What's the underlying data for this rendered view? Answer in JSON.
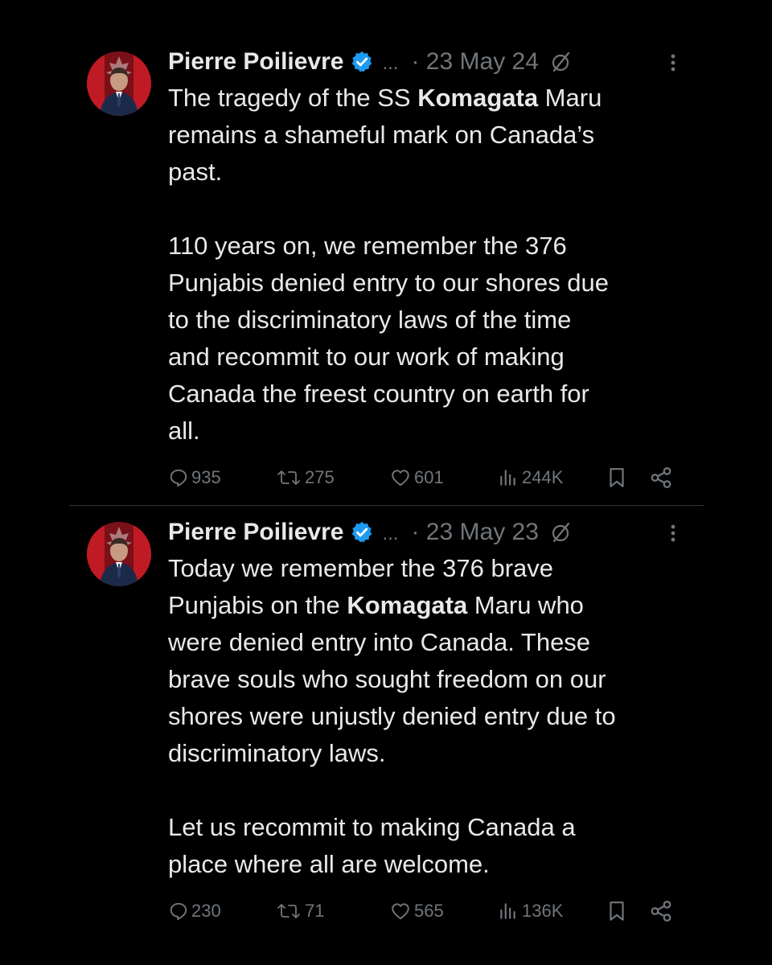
{
  "colors": {
    "background": "#000000",
    "text": "#e7e9ea",
    "secondary": "#71767b",
    "verified_badge": "#1d9bf0",
    "divider": "#2f3336"
  },
  "tweets": [
    {
      "author_name": "Pierre Poilievre",
      "ellipsis": "...",
      "date": "· 23 May 24",
      "body_lines": [
        [
          {
            "t": "The tragedy of the SS "
          },
          {
            "t": "Komagata",
            "b": true
          },
          {
            "t": " Maru"
          }
        ],
        [
          {
            "t": "remains a shameful mark on Canada’s"
          }
        ],
        [
          {
            "t": "past."
          }
        ],
        [],
        [
          {
            "t": "110 years on, we remember the 376"
          }
        ],
        [
          {
            "t": "Punjabis denied entry to our shores due"
          }
        ],
        [
          {
            "t": "to the discriminatory laws of the time"
          }
        ],
        [
          {
            "t": "and recommit to our work of making"
          }
        ],
        [
          {
            "t": "Canada the freest country on earth for"
          }
        ],
        [
          {
            "t": "all."
          }
        ]
      ],
      "replies": "935",
      "reposts": "275",
      "likes": "601",
      "views": "244K"
    },
    {
      "author_name": "Pierre Poilievre",
      "ellipsis": "...",
      "date": "· 23 May 23",
      "body_lines": [
        [
          {
            "t": "Today we remember the 376 brave"
          }
        ],
        [
          {
            "t": "Punjabis on the "
          },
          {
            "t": "Komagata",
            "b": true
          },
          {
            "t": " Maru who"
          }
        ],
        [
          {
            "t": "were denied entry into Canada. These"
          }
        ],
        [
          {
            "t": "brave souls who sought freedom on our"
          }
        ],
        [
          {
            "t": "shores were unjustly denied entry due to"
          }
        ],
        [
          {
            "t": "discriminatory laws."
          }
        ],
        [],
        [
          {
            "t": "Let us recommit to making Canada a"
          }
        ],
        [
          {
            "t": "place where all are welcome."
          }
        ]
      ],
      "replies": "230",
      "reposts": "71",
      "likes": "565",
      "views": "136K"
    }
  ]
}
